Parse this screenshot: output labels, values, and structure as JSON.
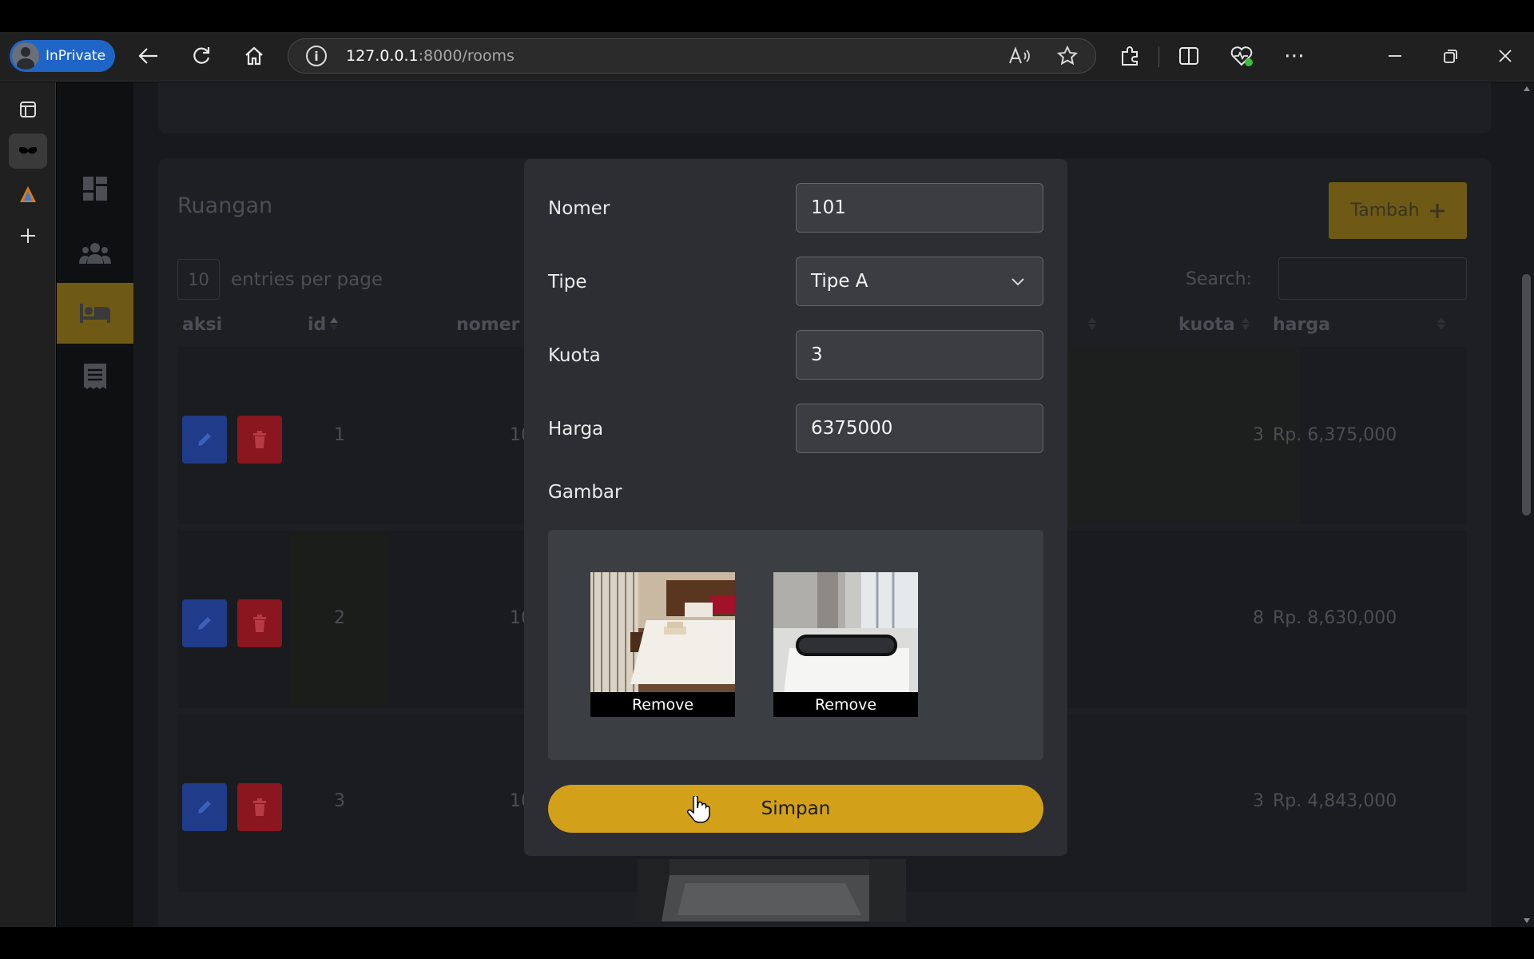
{
  "browser": {
    "profile_label": "InPrivate",
    "url_host": "127.0.0.1",
    "url_path": ":8000/rooms"
  },
  "page": {
    "section_title": "Ruangan",
    "add_button": "Tambah",
    "entries_value": "10",
    "entries_label": "entries per page",
    "search_label": "Search:",
    "columns": {
      "aksi": "aksi",
      "id": "id",
      "nomer": "nomer",
      "kuota": "kuota",
      "harga": "harga"
    },
    "rows": [
      {
        "id": "1",
        "nomer": "10",
        "kuota": "3",
        "harga": "Rp. 6,375,000"
      },
      {
        "id": "2",
        "nomer": "10",
        "kuota": "8",
        "harga": "Rp. 8,630,000"
      },
      {
        "id": "3",
        "nomer": "10",
        "kuota": "3",
        "harga": "Rp. 4,843,000"
      }
    ]
  },
  "modal": {
    "nomer_label": "Nomer",
    "nomer_value": "101",
    "tipe_label": "Tipe",
    "tipe_value": "Tipe A",
    "kuota_label": "Kuota",
    "kuota_value": "3",
    "harga_label": "Harga",
    "harga_value": "6375000",
    "gambar_label": "Gambar",
    "remove_label_1": "Remove",
    "remove_label_2": "Remove",
    "save_button": "Simpan"
  },
  "colors": {
    "accent": "#d3a119",
    "edit": "#1f3b8a",
    "delete": "#8a1620"
  }
}
